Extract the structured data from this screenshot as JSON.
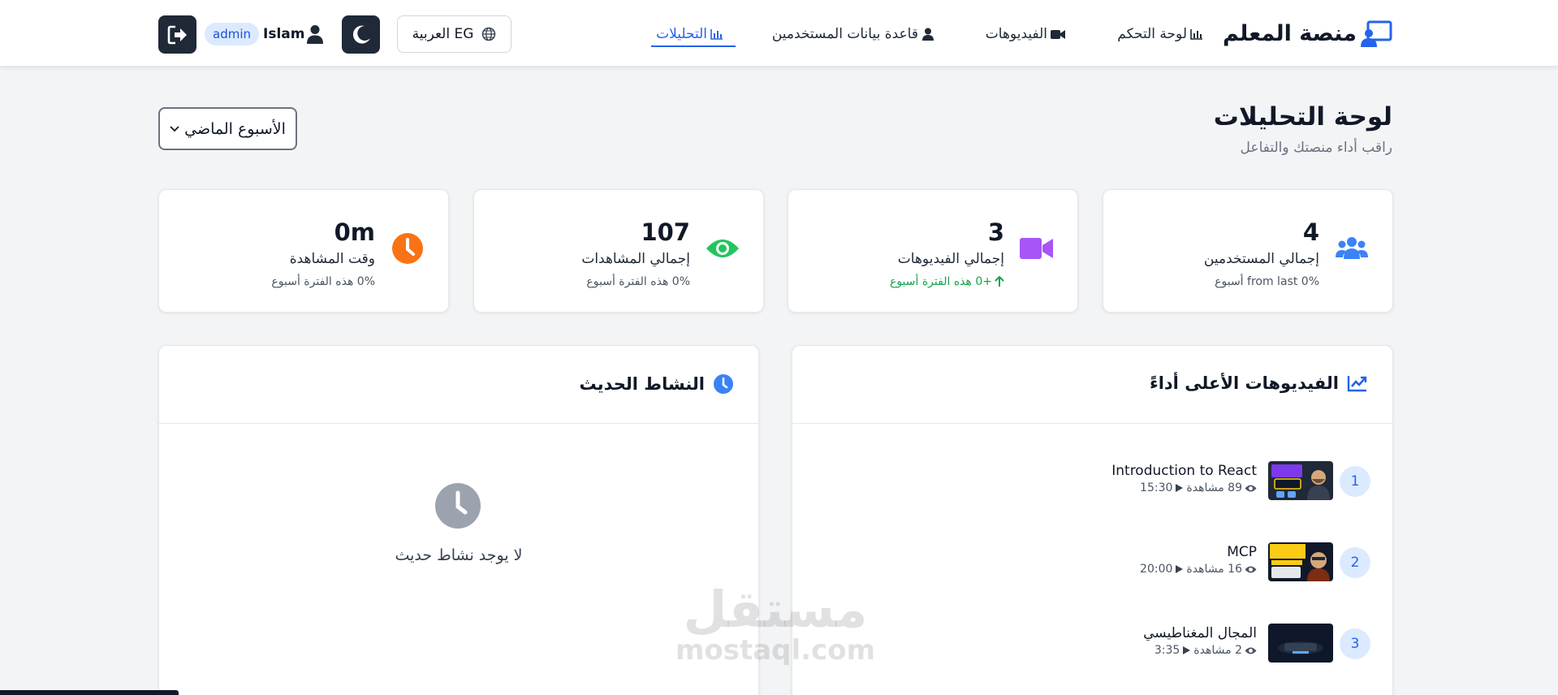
{
  "colors": {
    "primary": "#2563eb",
    "dark_button": "#1f2937",
    "users_icon": "#3b82f6",
    "videos_icon": "#a855f7",
    "views_icon": "#22c55e",
    "watch_icon": "#f97316",
    "positive": "#16a34a"
  },
  "nav": {
    "brand": "منصة المعلم",
    "links": [
      {
        "label": "لوحة التحكم",
        "icon": "chart-bars-icon"
      },
      {
        "label": "الفيديوهات",
        "icon": "video-camera-icon"
      },
      {
        "label": "قاعدة بيانات المستخدمين",
        "icon": "user-icon"
      },
      {
        "label": "التحليلات",
        "icon": "chart-bars-icon",
        "active": true
      }
    ],
    "language": "EG العربية",
    "user_name": "Islam",
    "role": "admin"
  },
  "header": {
    "title": "لوحة التحليلات",
    "subtitle": "راقب أداء منصتك والتفاعل",
    "period": "الأسبوع الماضي"
  },
  "stats": [
    {
      "value": "4",
      "label": "إجمالي المستخدمين",
      "change": "0% from last أسبوع",
      "icon": "users-icon"
    },
    {
      "value": "3",
      "label": "إجمالي الفيديوهات",
      "change": "+0 هذه الفترة أسبوع",
      "icon": "video-camera-icon"
    },
    {
      "value": "107",
      "label": "إجمالي المشاهدات",
      "change": "0% هذه الفترة أسبوع",
      "icon": "eye-icon"
    },
    {
      "value": "0m",
      "label": "وقت المشاهدة",
      "change": "0% هذه الفترة أسبوع",
      "icon": "clock-icon"
    }
  ],
  "top_videos": {
    "title": "الفيديوهات الأعلى أداءً",
    "items": [
      {
        "rank": "1",
        "title": "Introduction to React",
        "views": "89 مشاهدة",
        "duration": "15:30"
      },
      {
        "rank": "2",
        "title": "MCP",
        "views": "16 مشاهدة",
        "duration": "20:00"
      },
      {
        "rank": "3",
        "title": "المجال المغناطيسي",
        "views": "2 مشاهدة",
        "duration": "3:35"
      }
    ]
  },
  "recent_activity": {
    "title": "النشاط الحديث",
    "empty": "لا يوجد نشاط حديث"
  },
  "watermark": {
    "arabic": "مستقل",
    "latin": "mostaql.com"
  }
}
